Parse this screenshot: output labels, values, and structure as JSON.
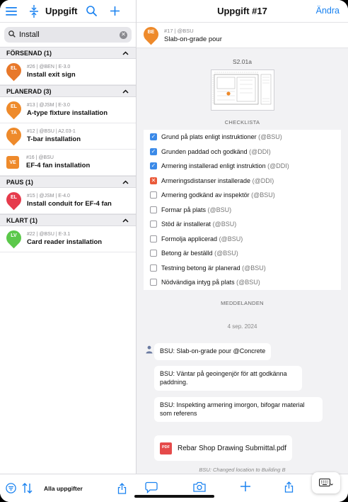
{
  "left": {
    "title": "Uppgifter",
    "search": {
      "value": "Install",
      "placeholder": "Sök"
    },
    "groups": [
      {
        "label": "FÖRSENAD (1)",
        "items": [
          {
            "badge": "EL",
            "meta": "#26 | @BEN | E-3.0",
            "name": "Install exit sign",
            "color": "#e8782a",
            "shape": "pin"
          }
        ]
      },
      {
        "label": "PLANERAD (3)",
        "items": [
          {
            "badge": "EL",
            "meta": "#13 | @JSM | E-3.0",
            "name": "A-type fixture installation",
            "color": "#ee8a2b",
            "shape": "pin"
          },
          {
            "badge": "TA",
            "meta": "#12 | @BSU | A2.03-1",
            "name": "T-bar installation",
            "color": "#ee8a2b",
            "shape": "pin"
          },
          {
            "badge": "VE",
            "meta": "#16 | @BSU",
            "name": "EF-4 fan installation",
            "color": "#ee8a2b",
            "shape": "square"
          }
        ]
      },
      {
        "label": "PAUS (1)",
        "items": [
          {
            "badge": "EL",
            "meta": "#15 | @JSM | E-4.0",
            "name": "Install conduit for EF-4 fan",
            "color": "#e63b4c",
            "shape": "pin"
          }
        ]
      },
      {
        "label": "KLART (1)",
        "items": [
          {
            "badge": "LV",
            "meta": "#22 | @BSU | E-3.1",
            "name": "Card reader installation",
            "color": "#5bc84a",
            "shape": "pin"
          }
        ]
      }
    ],
    "footer_label": "Alla uppgifter"
  },
  "right": {
    "title": "Uppgift #17",
    "edit_label": "Ändra",
    "task": {
      "badge": "BE",
      "meta": "#17 | @BSU",
      "name": "Slab-on-grade pour",
      "color": "#ee8a2b"
    },
    "drawing_label": "S2.01a",
    "checklist_title": "CHECKLISTA",
    "checklist": [
      {
        "text": "Grund på plats enligt instruktioner",
        "who": "(@BSU)",
        "state": "done"
      },
      {
        "text": "Grunden paddad och godkänd",
        "who": "(@DDI)",
        "state": "done"
      },
      {
        "text": "Armering installerad enligt instruktion",
        "who": "(@DDI)",
        "state": "done"
      },
      {
        "text": "Armeringsdistanser installerade",
        "who": "(@DDI)",
        "state": "failed"
      },
      {
        "text": "Armering godkänd av inspektör",
        "who": "(@BSU)",
        "state": "open"
      },
      {
        "text": "Formar på plats",
        "who": "(@BSU)",
        "state": "open"
      },
      {
        "text": "Stöd är installerat",
        "who": "(@BSU)",
        "state": "open"
      },
      {
        "text": "Formolja applicerad",
        "who": "(@BSU)",
        "state": "open"
      },
      {
        "text": "Betong är beställd",
        "who": "(@BSU)",
        "state": "open"
      },
      {
        "text": "Testning betong är planerad",
        "who": "(@BSU)",
        "state": "open"
      },
      {
        "text": "Nödvändiga intyg på plats",
        "who": "(@BSU)",
        "state": "open"
      }
    ],
    "messages_title": "MEDDELANDEN",
    "date": "4 sep. 2024",
    "messages": [
      "BSU: Slab-on-grade pour @Concrete",
      "BSU: Väntar på geoingenjör för att godkänna paddning.",
      "BSU: Inspekting armering imorgon, bifogar material som referens"
    ],
    "attachment": {
      "icon": "PDF",
      "name": "Rebar Shop Drawing Submittal.pdf"
    },
    "location_note": "BSU: Changed location to Building B"
  }
}
